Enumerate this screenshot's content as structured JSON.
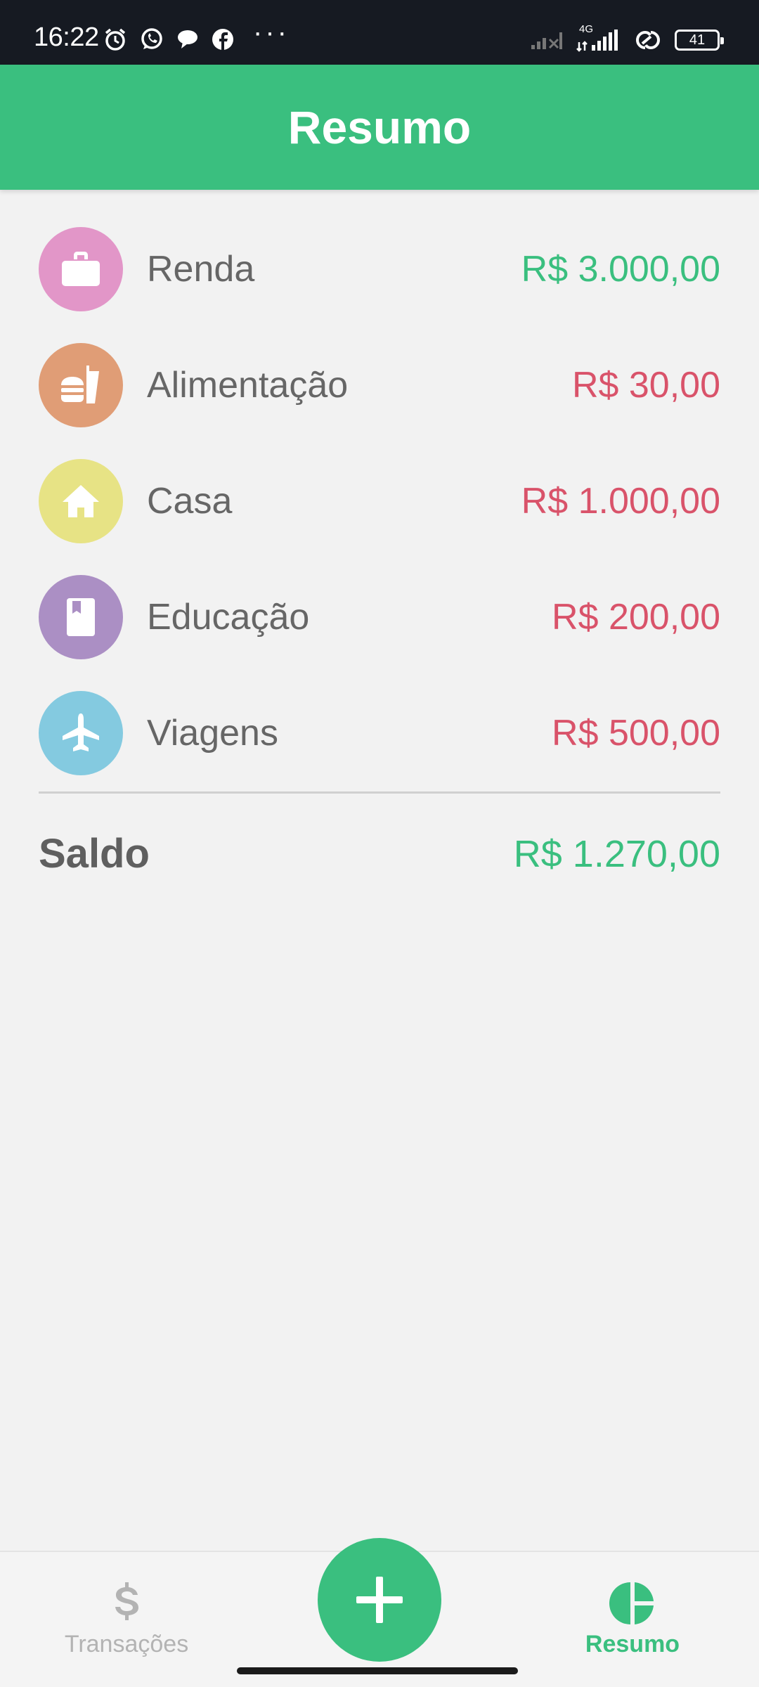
{
  "status_bar": {
    "time": "16:22",
    "more": "···",
    "network": "4G",
    "battery": "41"
  },
  "header": {
    "title": "Resumo"
  },
  "categories": [
    {
      "name": "Renda",
      "amount": "R$ 3.000,00",
      "icon": "briefcase-icon",
      "icon_color": "#e296c8",
      "amount_color": "#3abf7f"
    },
    {
      "name": "Alimentação",
      "amount": "R$ 30,00",
      "icon": "fastfood-icon",
      "icon_color": "#e09d76",
      "amount_color": "#d9536a"
    },
    {
      "name": "Casa",
      "amount": "R$ 1.000,00",
      "icon": "house-icon",
      "icon_color": "#e7e385",
      "amount_color": "#d9536a"
    },
    {
      "name": "Educação",
      "amount": "R$ 200,00",
      "icon": "book-icon",
      "icon_color": "#ab8fc4",
      "amount_color": "#d9536a"
    },
    {
      "name": "Viagens",
      "amount": "R$ 500,00",
      "icon": "airplane-icon",
      "icon_color": "#84cae0",
      "amount_color": "#d9536a"
    }
  ],
  "balance": {
    "label": "Saldo",
    "amount": "R$ 1.270,00",
    "amount_color": "#3abf7f"
  },
  "bottom_nav": {
    "tabs": [
      {
        "label": "Transações",
        "icon": "dollar-icon",
        "active": false,
        "color": "#b3b3b3"
      },
      {
        "label": "Resumo",
        "icon": "pie-chart-icon",
        "active": true,
        "color": "#3abf7f"
      }
    ],
    "fab_icon": "plus-icon"
  },
  "colors": {
    "accent": "#3abf7f",
    "expense": "#d9536a",
    "text": "#666666",
    "status_bar": "#161a22"
  }
}
